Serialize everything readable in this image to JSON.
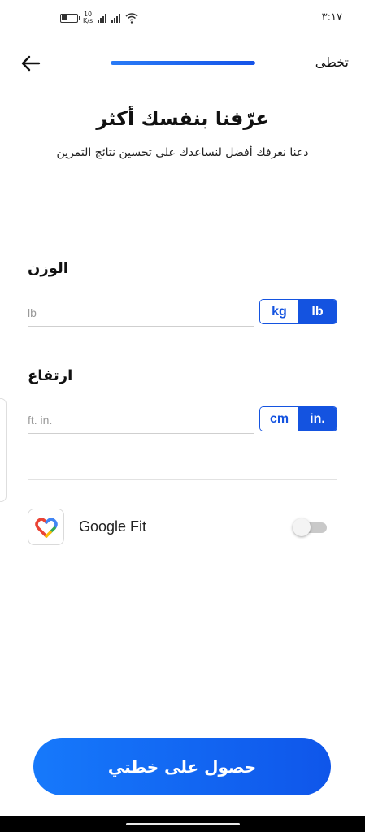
{
  "status_bar": {
    "net_speed_value": "10",
    "net_speed_unit": "K/s",
    "time": "٣:١٧"
  },
  "top_bar": {
    "skip_label": "تخطى",
    "progress_fraction": 1.0
  },
  "header": {
    "title": "عرّفنا بنفسك أكثر",
    "subtitle": "دعنا نعرفك أفضل لنساعدك على تحسين نتائج التمرين"
  },
  "weight": {
    "label": "الوزن",
    "placeholder": "lb",
    "units": [
      "kg",
      "lb"
    ],
    "selected_unit": "lb"
  },
  "height": {
    "label": "ارتفاع",
    "placeholder": "ft. in.",
    "units": [
      "cm",
      "in."
    ],
    "selected_unit": "in."
  },
  "google_fit": {
    "label": "Google Fit",
    "enabled": false,
    "icon": "google-fit-heart-icon"
  },
  "cta": {
    "label": "حصول على خطتي"
  },
  "colors": {
    "accent": "#1453e0",
    "button_gradient_start": "#1679fb",
    "button_gradient_end": "#0f56ea"
  }
}
